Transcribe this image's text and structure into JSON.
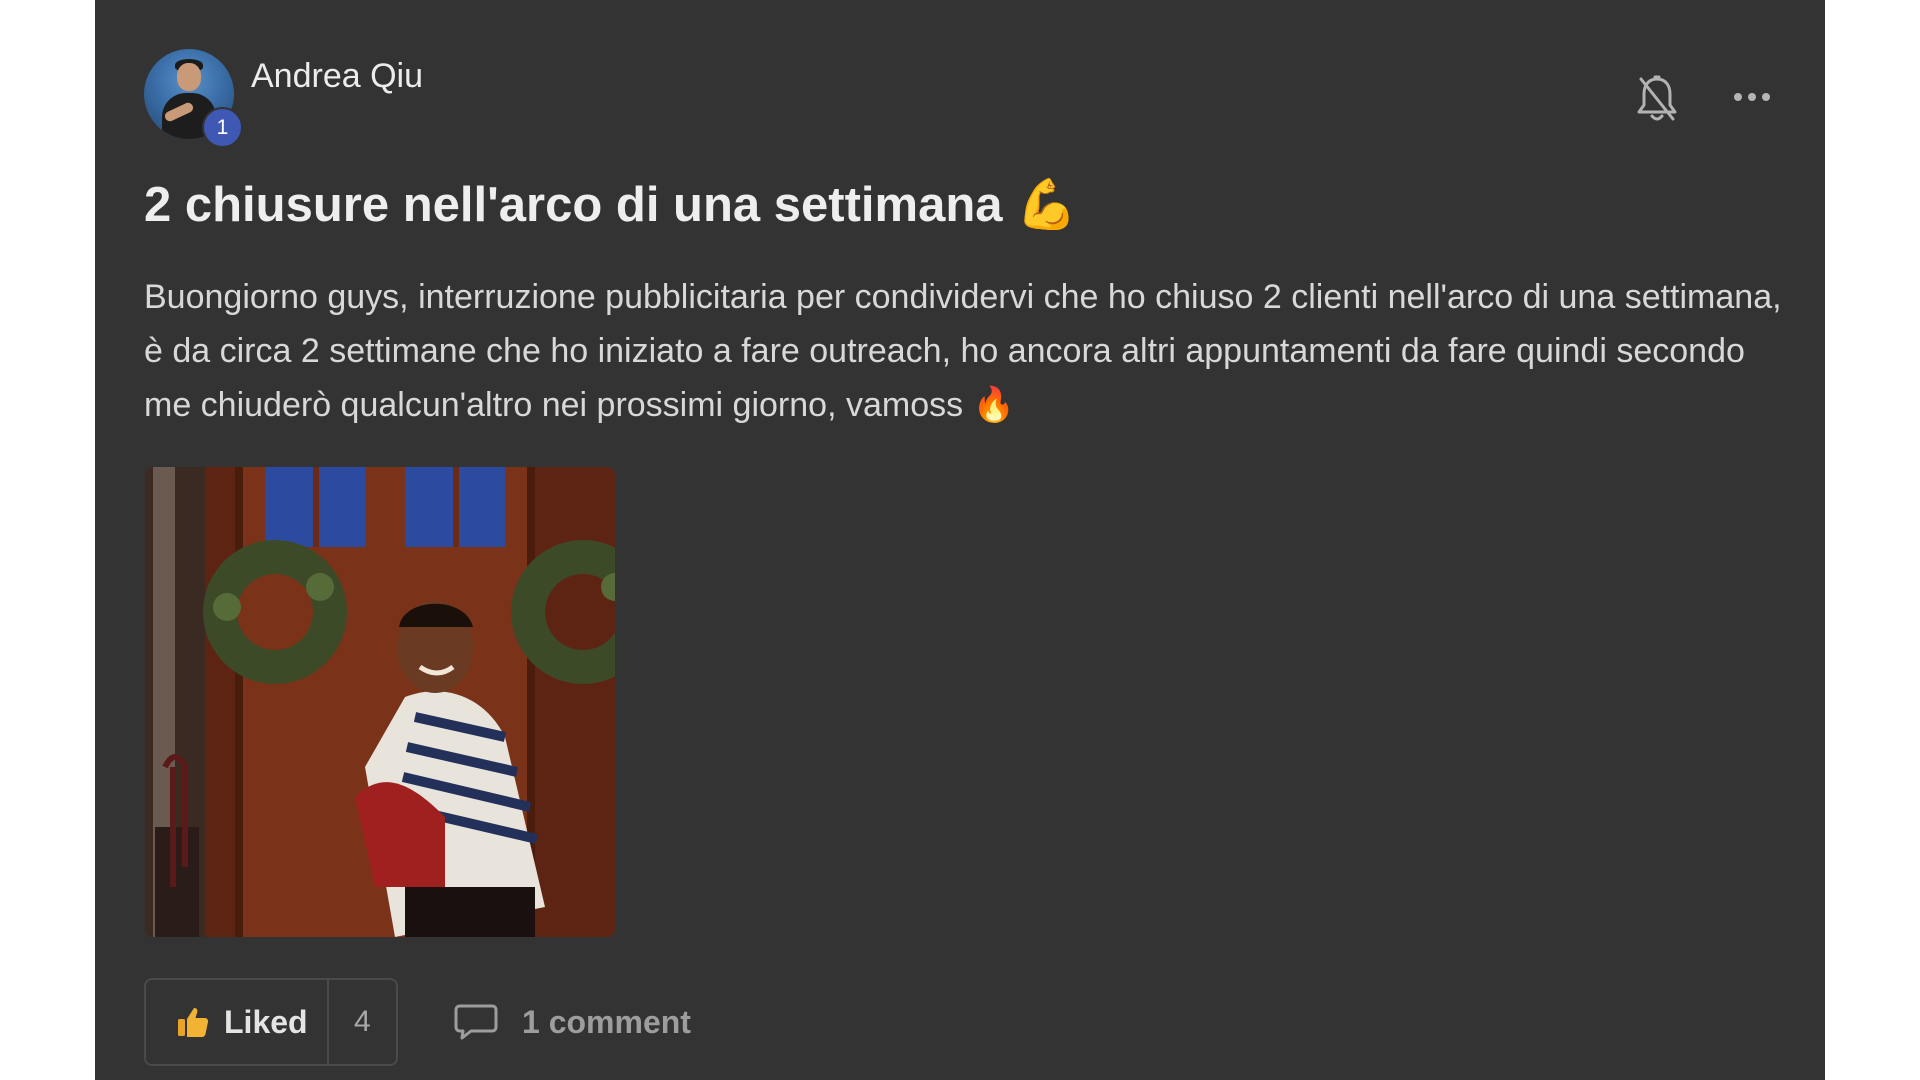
{
  "post": {
    "author": {
      "name": "Andrea Qiu",
      "level": "1"
    },
    "title": "2 chiusure nell'arco di una settimana",
    "title_emoji": "💪",
    "body": "Buongiorno guys, interruzione pubblicitaria per condividervi che ho chiuso 2 clienti nell'arco di una settimana, è da circa 2 settimane che ho iniziato a fare outreach, ho ancora altri appuntamenti da fare quindi secondo me chiuderò qualcun'altro nei prossimi giorno, vamoss",
    "body_emoji": "🔥",
    "media": {
      "type": "gif",
      "icon": "dancing-man-gif"
    },
    "actions": {
      "like_label": "Liked",
      "like_count": "4",
      "comment_label": "1 comment"
    }
  },
  "icons": {
    "notifications": "bell-off-icon",
    "more": "more-horizontal-icon",
    "like": "thumbs-up-icon",
    "comment": "comment-bubble-icon"
  },
  "colors": {
    "card_background": "#333333",
    "level_badge": "#3f58b3",
    "like_icon": "#f2b233",
    "fire_emoji": "#ff7a1a"
  }
}
